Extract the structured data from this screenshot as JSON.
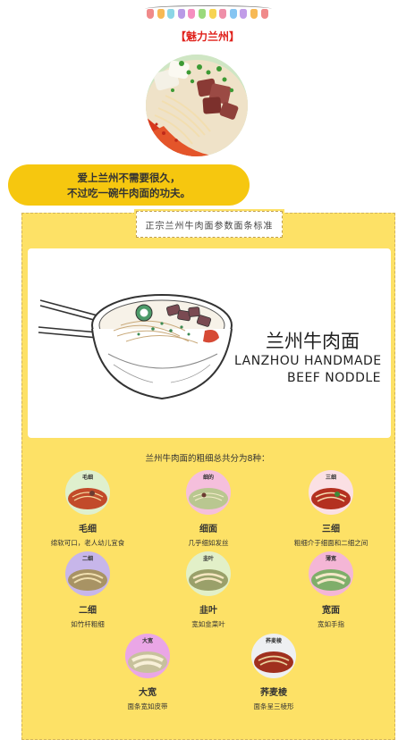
{
  "decor": {
    "bulb_colors": [
      "#f08a8a",
      "#f7b955",
      "#8cd6e6",
      "#b99ae6",
      "#f58fc0",
      "#9ad97c",
      "#f7d352",
      "#ef8fa8",
      "#86c5f2",
      "#c19ce8",
      "#f7b955",
      "#f08a8a"
    ]
  },
  "header": {
    "section_title": "【魅力兰州】"
  },
  "quote": {
    "line1": "爱上兰州不需要很久，",
    "line2": "不过吃一碗牛肉面的功夫。"
  },
  "panel": {
    "tag": "正宗兰州牛肉面参数面条标准",
    "banner": {
      "title_cn": "兰州牛肉面",
      "title_en_line1": "LANZHOU HANDMADE",
      "title_en_line2": "BEEF NODDLE"
    },
    "intro": "兰州牛肉面的粗细总共分为8种：",
    "types": [
      {
        "thumb_label": "毛细",
        "name": "毛细",
        "desc": "绵软可口，老人幼儿宜食",
        "bg": "#dff0ce"
      },
      {
        "thumb_label": "细的",
        "name": "细面",
        "desc": "几乎细如发丝",
        "bg": "#f5bfdc"
      },
      {
        "thumb_label": "三细",
        "name": "三细",
        "desc": "粗细介于细面和二细之间",
        "bg": "#fbe0e4"
      },
      {
        "thumb_label": "二细",
        "name": "二细",
        "desc": "如竹杆粗细",
        "bg": "#c7b6ea"
      },
      {
        "thumb_label": "韭叶",
        "name": "韭叶",
        "desc": "宽如韭菜叶",
        "bg": "#e2f0c8"
      },
      {
        "thumb_label": "薄宽",
        "name": "宽面",
        "desc": "宽如手指",
        "bg": "#f4b6d6"
      },
      {
        "thumb_label": "大宽",
        "name": "大宽",
        "desc": "面条宽如皮带",
        "bg": "#eaa6e6"
      },
      {
        "thumb_label": "荞麦棱",
        "name": "荞麦棱",
        "desc": "面条呈三棱形",
        "bg": "#eef0f2"
      }
    ]
  }
}
